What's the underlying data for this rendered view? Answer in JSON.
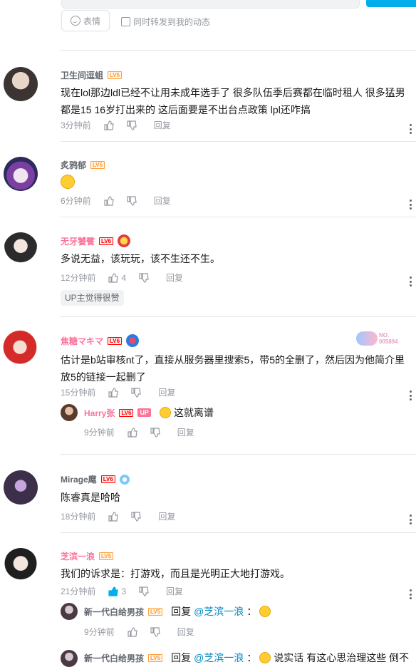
{
  "editor": {
    "emoji_label": "表情",
    "repost_label": "同时转发到我的动态"
  },
  "actions": {
    "reply_label": "回复"
  },
  "fan_badge": {
    "line1": "NO.",
    "line2": "005894"
  },
  "comments": [
    {
      "user": "卫生间逗蛆",
      "level": "LV5",
      "text_line1": "现在lol那边ldl已经不让用未成年选手了  很多队伍季后赛都在临时租人  很多猛男",
      "text_line2": "都是15 16岁打出来的  这后面要是不出台点政策  lpl还咋搞",
      "time": "3分钟前",
      "likes": ""
    },
    {
      "user": "炙鸦郁",
      "level": "LV5",
      "time": "6分钟前",
      "likes": "",
      "emoji": "smug-emoji"
    },
    {
      "user": "无牙饕餮",
      "level": "LV6",
      "text": "多说无益，该玩玩，该不生还不生。",
      "time": "12分钟前",
      "likes": "4",
      "up_flag": "UP主觉得很赞"
    },
    {
      "user": "焦糖マキマ",
      "level": "LV6",
      "text_line1": "估计是b站审核nt了，直接从服务器里搜索5，带5的全删了，然后因为他简介里",
      "text_line2": "放5的链接一起删了",
      "time": "15分钟前",
      "likes": "",
      "reply": {
        "user": "Harry张",
        "level": "LV6",
        "up": "UP",
        "text": "这就离谱",
        "time": "9分钟前"
      }
    },
    {
      "user": "Mirage麾",
      "level": "LV6",
      "text": "陈睿真是哈哈",
      "time": "18分钟前",
      "likes": ""
    },
    {
      "user": "芝滨一浪",
      "level": "LV5",
      "text": "我们的诉求是：打游戏，而且是光明正大地打游戏。",
      "time": "21分钟前",
      "likes": "3",
      "reply1": {
        "user": "新一代白给男孩",
        "level": "LV5",
        "prefix": "回复",
        "at": "@芝滨一浪",
        "colon": "：",
        "time": "9分钟前"
      },
      "reply2": {
        "user": "新一代白给男孩",
        "level": "LV5",
        "prefix": "回复",
        "at": "@芝滨一浪",
        "colon": "：",
        "text": "说实话 有这心思治理这些 倒不"
      }
    }
  ],
  "colors": {
    "accent": "#00aeec",
    "vip_pink": "#fb7299",
    "link": "#008ac5"
  }
}
